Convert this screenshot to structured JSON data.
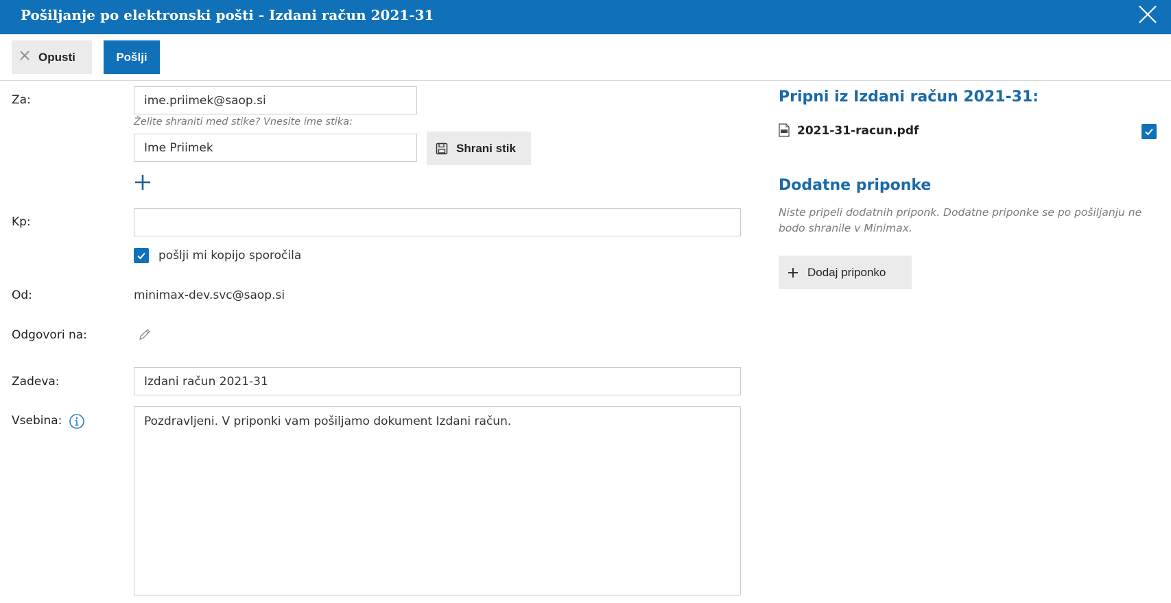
{
  "window": {
    "title": "Pošiljanje po elektronski pošti - Izdani račun 2021-31"
  },
  "toolbar": {
    "cancel_label": "Opusti",
    "send_label": "Pošlji"
  },
  "form": {
    "to_label": "Za:",
    "to_value": "ime.priimek@saop.si",
    "save_contact_hint": "Želite shraniti med stike? Vnesite ime stika:",
    "contact_name_value": "Ime Priimek",
    "save_contact_label": "Shrani stik",
    "cc_label": "Kp:",
    "cc_value": "",
    "send_copy_label": "pošlji mi kopijo sporočila",
    "send_copy_checked": true,
    "from_label": "Od:",
    "from_value": "minimax-dev.svc@saop.si",
    "reply_to_label": "Odgovori na:",
    "subject_label": "Zadeva:",
    "subject_value": "Izdani račun 2021-31",
    "body_label": "Vsebina:",
    "body_value": "Pozdravljeni. V priponki vam pošiljamo dokument Izdani račun."
  },
  "attachments": {
    "title": "Pripni iz Izdani račun 2021-31:",
    "files": [
      {
        "name": "2021-31-racun.pdf",
        "icon": "pdf-file-icon",
        "checked": true
      }
    ],
    "additional_title": "Dodatne priponke",
    "additional_note": "Niste pripeli dodatnih priponk. Dodatne priponke se po pošiljanju ne bodo shranile v Minimax.",
    "add_label": "Dodaj priponko"
  },
  "colors": {
    "accent": "#1071b8",
    "section_title": "#1a6aa8",
    "button_gray": "#ebebeb"
  }
}
